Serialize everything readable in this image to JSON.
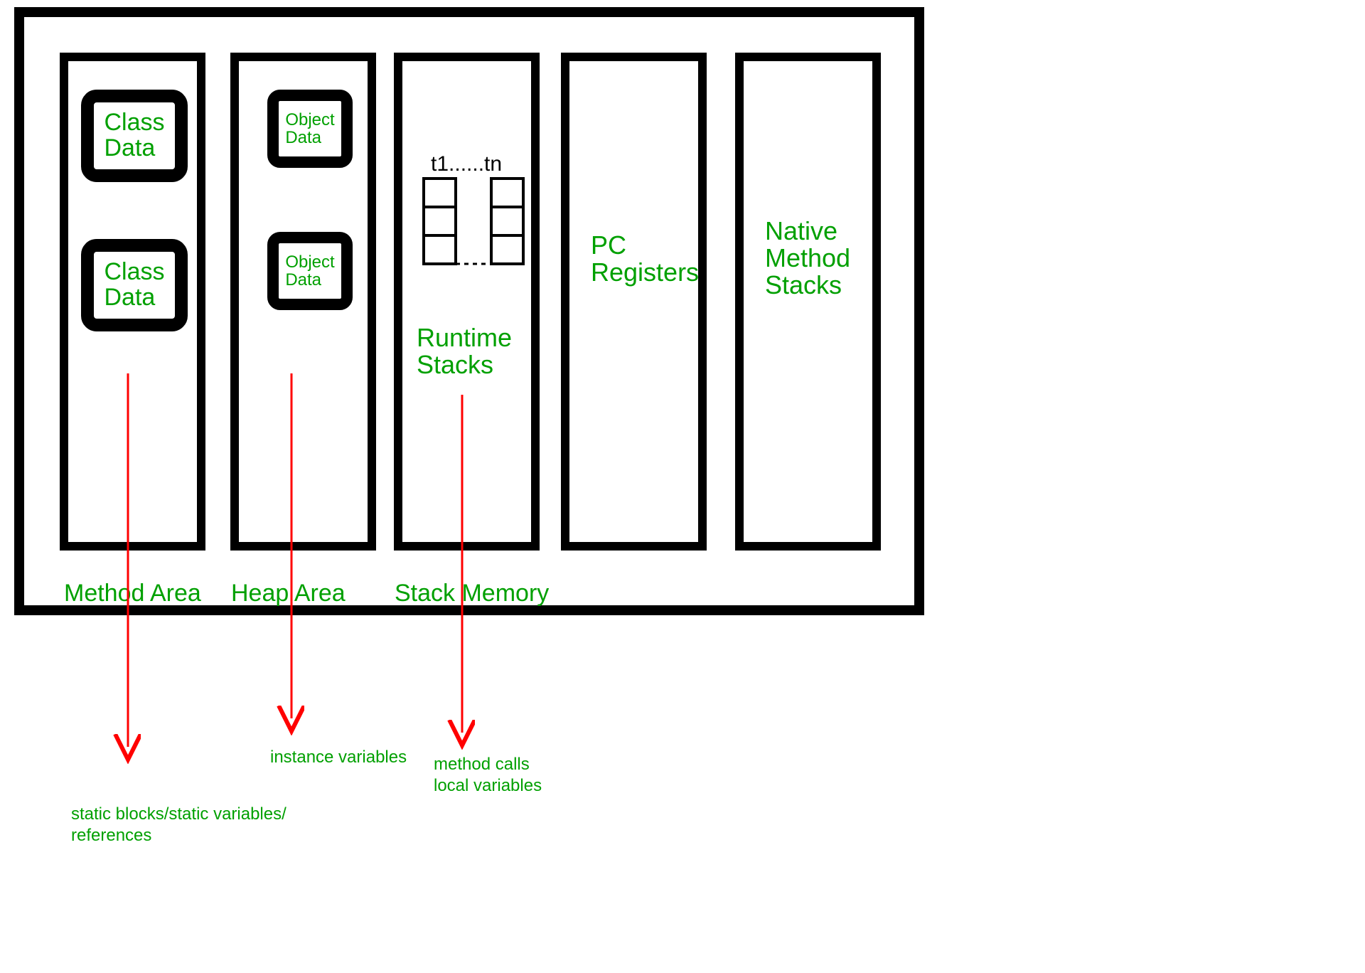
{
  "columns": {
    "method_area": {
      "label": "Method Area",
      "box1": "Class\nData",
      "box2": "Class\nData",
      "footnote": "static blocks/static variables/\nreferences"
    },
    "heap_area": {
      "label": "Heap Area",
      "box1": "Object\nData",
      "box2": "Object\nData",
      "footnote": "instance variables"
    },
    "stack_memory": {
      "label": "Stack Memory",
      "threads_label": "t1......tn",
      "runtime_label": "Runtime\nStacks",
      "footnote": "method calls\nlocal variables"
    },
    "pc_registers": {
      "label": "PC\nRegisters"
    },
    "native_stacks": {
      "label": "Native\nMethod\nStacks"
    }
  },
  "colors": {
    "accent": "#00a000",
    "arrow": "#ff0000",
    "border": "#000000"
  }
}
